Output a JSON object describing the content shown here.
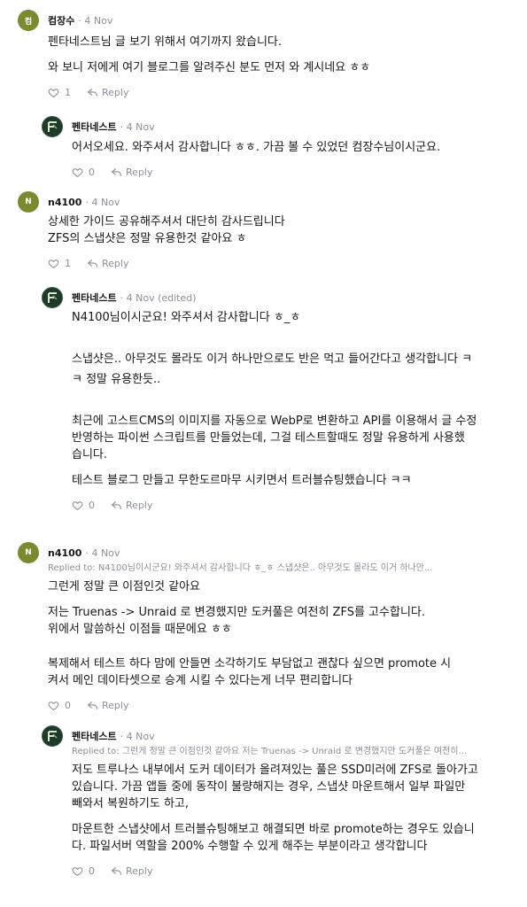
{
  "comments": [
    {
      "author": "컴장수",
      "avatar_text": "컴",
      "date": "4 Nov",
      "paragraphs": [
        "펜타네스트님 글 보기 위해서 여기까지 왔습니다.",
        "와 보니 저에게 여기 블로그를 알려주신 분도 먼저 와 계시네요 ㅎㅎ"
      ],
      "likes": "1",
      "reply_label": "Reply"
    },
    {
      "author": "펜타네스트",
      "date": "4 Nov",
      "paragraphs": [
        "어서오세요. 와주셔서 감사합니다 ㅎㅎ. 가끔 볼 수 있었던 컴장수님이시군요."
      ],
      "likes": "0",
      "reply_label": "Reply"
    },
    {
      "author": "n4100",
      "avatar_text": "N",
      "date": "4 Nov",
      "paragraphs": [
        "상세한 가이드 공유해주셔서 대단히 감사드립니다",
        "ZFS의 스냅샷은 정말 유용한것 같아요 ㅎ"
      ],
      "likes": "1",
      "reply_label": "Reply"
    },
    {
      "author": "펜타네스트",
      "date": "4 Nov (edited)",
      "paragraphs": [
        "N4100님이시군요! 와주셔서 감사합니다 ㅎ_ㅎ",
        "스냅샷은.. 아무것도 몰라도 이거 하나만으로도 반은 먹고 들어간다고 생각합니다 ㅋ",
        "ㅋ 정말 유용한듯..",
        "최근에 고스트CMS의 이미지를 자동으로 WebP로 변환하고 API를 이용해서 글 수정",
        "반영하는 파이썬 스크립트를 만들었는데, 그걸 테스트할때도 정말 유용하게 사용했",
        "습니다.",
        "테스트 블로그 만들고 무한도르마무 시키면서 트러블슈팅했습니다 ㅋㅋ"
      ],
      "likes": "0",
      "reply_label": "Reply"
    },
    {
      "author": "n4100",
      "avatar_text": "N",
      "date": "4 Nov",
      "replied_to": "Replied to: N4100님이시군요! 와주셔서 감사합니다 ㅎ_ㅎ 스냅샷은.. 아무것도 몰라도 이거 하나만...",
      "paragraphs": [
        "그런게 정말 큰 이점인것 같아요",
        "저는 Truenas -> Unraid 로 변경했지만 도커풀은 여전히 ZFS를 고수합니다.",
        "위에서 말씀하신 이점들 때문에요 ㅎㅎ",
        "복제해서 테스트 하다 맘에 안들면 소각하기도 부담없고 괜찮다 싶으면 promote 시",
        "켜서 메인 데이타셋으로 승계 시킬 수 있다는게 너무 편리합니다"
      ],
      "likes": "0",
      "reply_label": "Reply"
    },
    {
      "author": "펜타네스트",
      "date": "4 Nov",
      "replied_to": "Replied to: 그런게 정말 큰 이점인것 같아요 저는 Truenas -> Unraid 로 변경했지만 도커풀은 여전히...",
      "paragraphs": [
        "저도 트루나스 내부에서 도커 데이터가 올려져있는 풀은 SSD미러에 ZFS로 돌아가고",
        "있습니다. 가끔 앱들 중에 동작이 불량해지는 경우, 스냅샷 마운트해서 일부 파일만",
        "빼와서 복원하기도 하고,",
        "마운트한 스냅샷에서 트러블슈팅해보고 해결되면 바로 promote하는 경우도 있습니",
        "다. 파일서버 역할을 200% 수행할 수 있게 해주는 부분이라고 생각합니다"
      ],
      "likes": "0",
      "reply_label": "Reply"
    }
  ]
}
